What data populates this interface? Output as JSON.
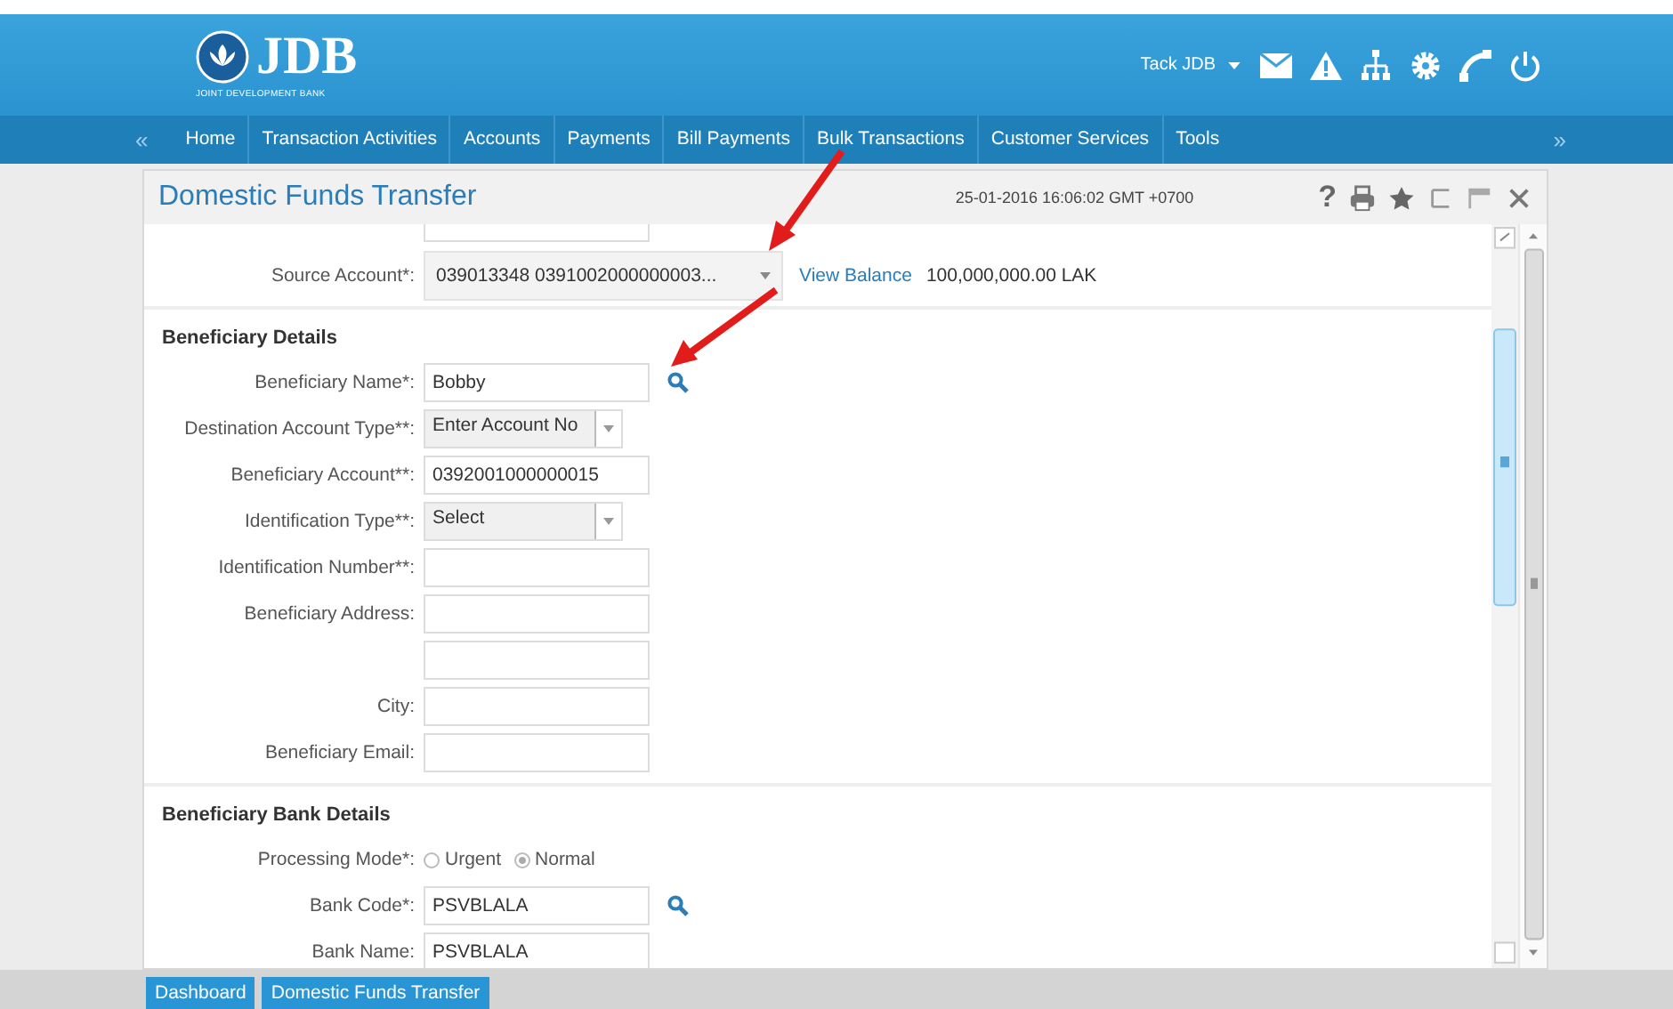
{
  "header": {
    "logo": {
      "name": "JDB",
      "tagline": "JOINT DEVELOPMENT BANK"
    },
    "user": "Tack JDB"
  },
  "nav": {
    "prev": "«",
    "next": "»",
    "items": [
      "Home",
      "Transaction Activities",
      "Accounts",
      "Payments",
      "Bill Payments",
      "Bulk Transactions",
      "Customer Services",
      "Tools"
    ]
  },
  "panel": {
    "title": "Domestic Funds Transfer",
    "timestamp": "25-01-2016 16:06:02 GMT +0700",
    "help": "?",
    "source": {
      "label": "Source Account*:",
      "value": "039013348 0391002000000003...",
      "link": "View Balance",
      "balance": "100,000,000.00 LAK"
    },
    "sections": [
      {
        "title": "Beneficiary Details",
        "fields": [
          {
            "label": "Beneficiary Name*:",
            "kind": "text",
            "value": "Bobby",
            "search": true
          },
          {
            "label": "Destination Account Type**:",
            "kind": "select",
            "value": "Enter Account No"
          },
          {
            "label": "Beneficiary Account**:",
            "kind": "text",
            "value": "0392001000000015"
          },
          {
            "label": "Identification Type**:",
            "kind": "select",
            "value": "Select"
          },
          {
            "label": "Identification Number**:",
            "kind": "text"
          },
          {
            "label": "Beneficiary Address:",
            "kind": "text"
          },
          {
            "kind": "text"
          },
          {
            "label": "City:",
            "kind": "text"
          },
          {
            "label": "Beneficiary Email:",
            "kind": "text"
          }
        ]
      },
      {
        "title": "Beneficiary Bank Details",
        "fields": [
          {
            "label": "Processing Mode*:",
            "kind": "radio",
            "options": [
              {
                "label": "Urgent",
                "selected": false
              },
              {
                "label": "Normal",
                "selected": true
              }
            ]
          },
          {
            "label": "Bank Code*:",
            "kind": "text",
            "value": "PSVBLALA",
            "search": true
          },
          {
            "label": "Bank Name:",
            "kind": "text",
            "value": "PSVBLALA"
          }
        ]
      }
    ]
  },
  "footer_tabs": [
    "Dashboard",
    "Domestic Funds Transfer"
  ]
}
